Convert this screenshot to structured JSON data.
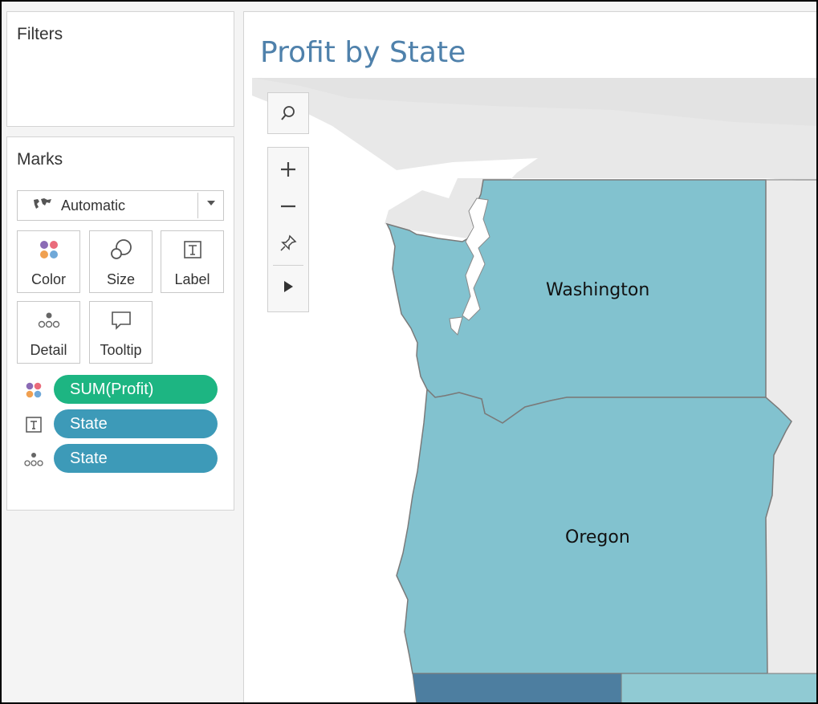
{
  "filters": {
    "title": "Filters"
  },
  "marks": {
    "title": "Marks",
    "mark_type": "Automatic",
    "buttons": [
      {
        "label": "Color",
        "icon": "color-dots-icon"
      },
      {
        "label": "Size",
        "icon": "size-icon"
      },
      {
        "label": "Label",
        "icon": "label-icon"
      },
      {
        "label": "Detail",
        "icon": "detail-icon"
      },
      {
        "label": "Tooltip",
        "icon": "tooltip-icon"
      }
    ],
    "pills": [
      {
        "field": "SUM(Profit)",
        "role": "color",
        "color": "#1db582"
      },
      {
        "field": "State",
        "role": "label",
        "color": "#3d9ab8"
      },
      {
        "field": "State",
        "role": "detail",
        "color": "#3d9ab8"
      }
    ]
  },
  "view": {
    "title": "Profit by State",
    "states": [
      {
        "name": "Washington",
        "fill": "#82c2cf"
      },
      {
        "name": "Oregon",
        "fill": "#82c2cf"
      }
    ],
    "toolbar": [
      "search-icon",
      "zoom-in-icon",
      "zoom-out-icon",
      "pin-icon",
      "expand-arrow-icon"
    ]
  },
  "colors": {
    "accent_title": "#4f81ab",
    "state_fill": "#82c2cf",
    "dark_state_fill": "#4d7ea0",
    "light_state_fill": "#90cad3",
    "basemap": "#e9e9e9"
  }
}
